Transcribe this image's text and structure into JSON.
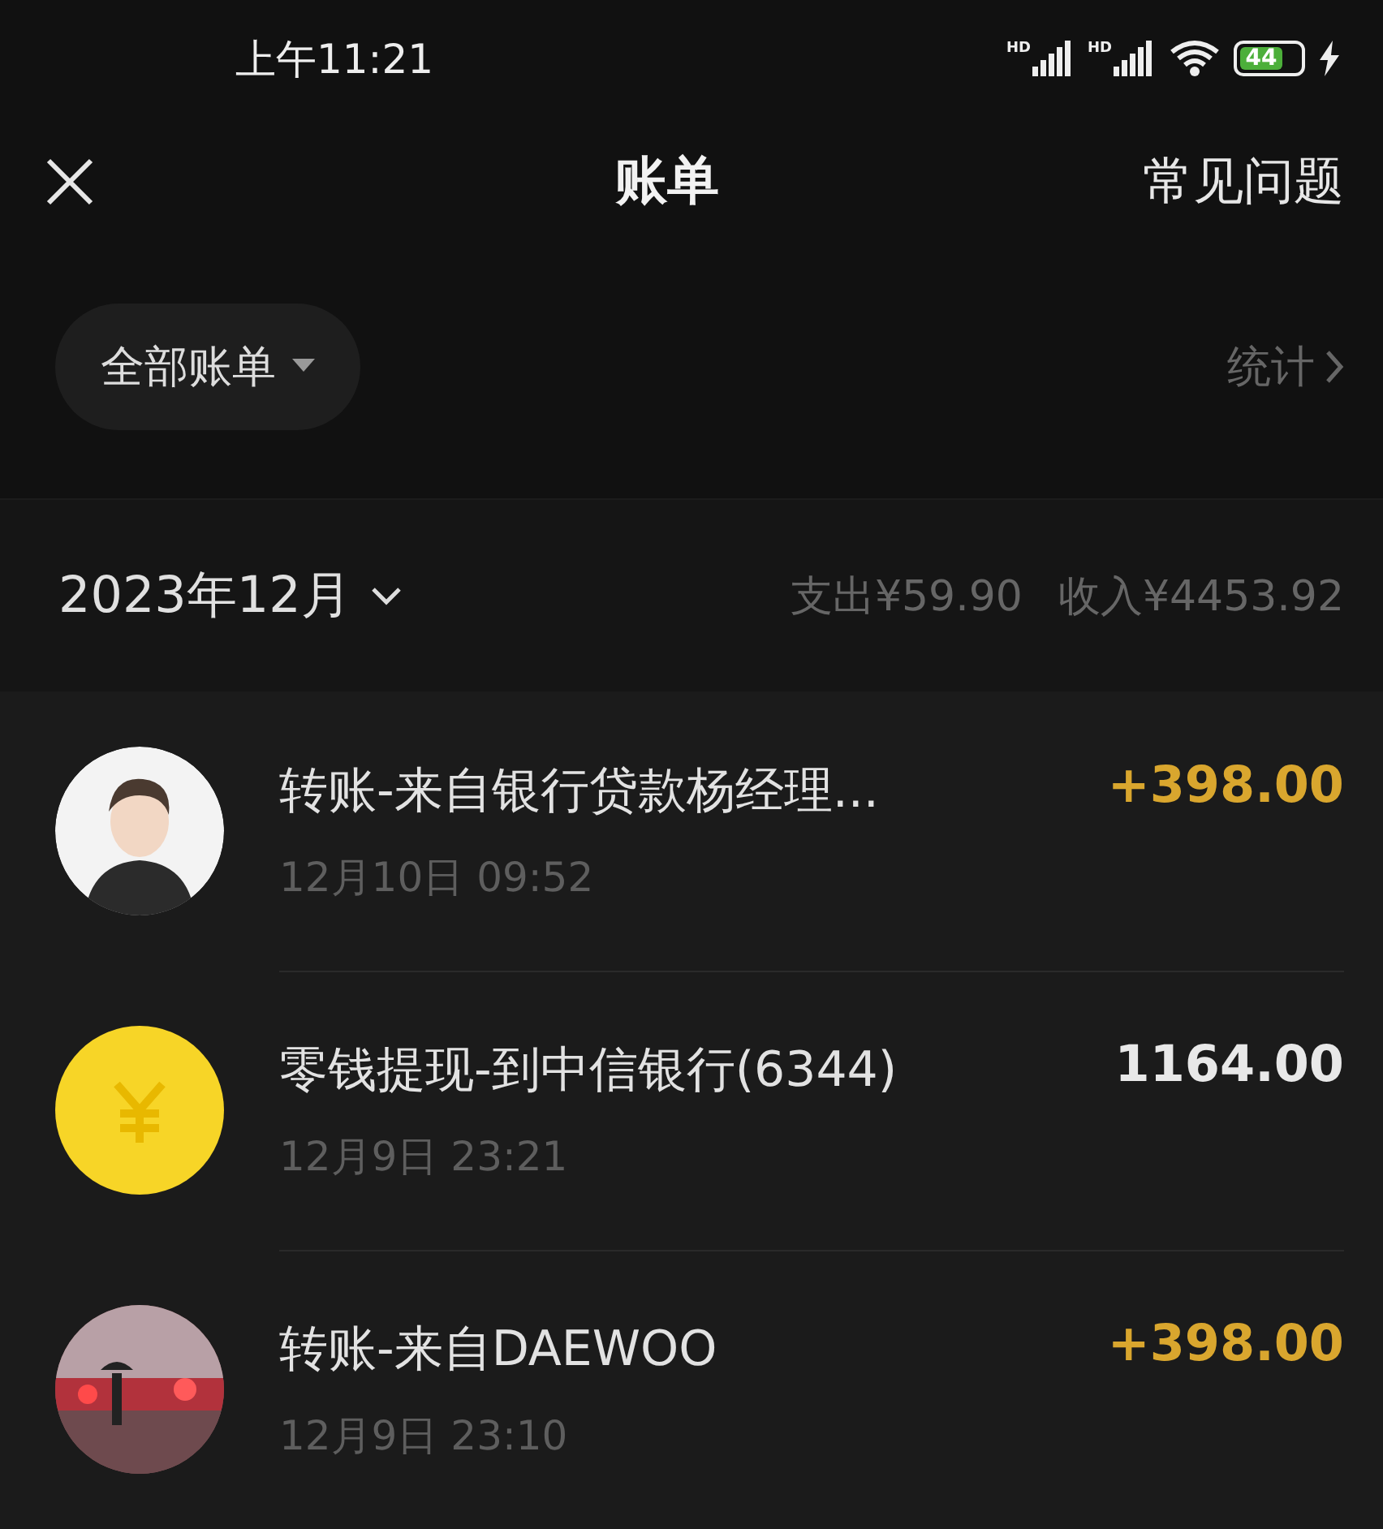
{
  "status_bar": {
    "time": "上午11:21",
    "signals": [
      "HD",
      "HD"
    ],
    "battery": "44"
  },
  "header": {
    "title": "账单",
    "action": "常见问题"
  },
  "filter": {
    "label": "全部账单",
    "stats": "统计"
  },
  "month": {
    "label": "2023年12月",
    "expense": "支出¥59.90",
    "income": "收入¥4453.92"
  },
  "transactions": [
    {
      "avatar": {
        "kind": "figure"
      },
      "title": "转账-来自银行贷款杨经理...",
      "time": "12月10日 09:52",
      "amount": "+398.00",
      "kind": "income"
    },
    {
      "avatar": {
        "kind": "coin"
      },
      "title": "零钱提现-到中信银行(6344)",
      "time": "12月9日 23:21",
      "amount": "1164.00",
      "kind": "withdrawal"
    },
    {
      "title": "转账-来自DAEWOO",
      "time": "12月9日 23:10",
      "amount": "+398.00",
      "kind": "income"
    }
  ]
}
